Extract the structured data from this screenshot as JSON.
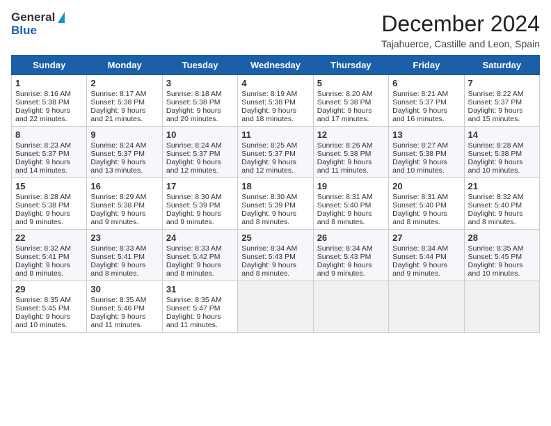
{
  "header": {
    "logo_general": "General",
    "logo_blue": "Blue",
    "month_title": "December 2024",
    "location": "Tajahuerce, Castille and Leon, Spain"
  },
  "days_of_week": [
    "Sunday",
    "Monday",
    "Tuesday",
    "Wednesday",
    "Thursday",
    "Friday",
    "Saturday"
  ],
  "weeks": [
    [
      {
        "day": 1,
        "lines": [
          "Sunrise: 8:16 AM",
          "Sunset: 5:38 PM",
          "Daylight: 9 hours",
          "and 22 minutes."
        ]
      },
      {
        "day": 2,
        "lines": [
          "Sunrise: 8:17 AM",
          "Sunset: 5:38 PM",
          "Daylight: 9 hours",
          "and 21 minutes."
        ]
      },
      {
        "day": 3,
        "lines": [
          "Sunrise: 8:18 AM",
          "Sunset: 5:38 PM",
          "Daylight: 9 hours",
          "and 20 minutes."
        ]
      },
      {
        "day": 4,
        "lines": [
          "Sunrise: 8:19 AM",
          "Sunset: 5:38 PM",
          "Daylight: 9 hours",
          "and 18 minutes."
        ]
      },
      {
        "day": 5,
        "lines": [
          "Sunrise: 8:20 AM",
          "Sunset: 5:38 PM",
          "Daylight: 9 hours",
          "and 17 minutes."
        ]
      },
      {
        "day": 6,
        "lines": [
          "Sunrise: 8:21 AM",
          "Sunset: 5:37 PM",
          "Daylight: 9 hours",
          "and 16 minutes."
        ]
      },
      {
        "day": 7,
        "lines": [
          "Sunrise: 8:22 AM",
          "Sunset: 5:37 PM",
          "Daylight: 9 hours",
          "and 15 minutes."
        ]
      }
    ],
    [
      {
        "day": 8,
        "lines": [
          "Sunrise: 8:23 AM",
          "Sunset: 5:37 PM",
          "Daylight: 9 hours",
          "and 14 minutes."
        ]
      },
      {
        "day": 9,
        "lines": [
          "Sunrise: 8:24 AM",
          "Sunset: 5:37 PM",
          "Daylight: 9 hours",
          "and 13 minutes."
        ]
      },
      {
        "day": 10,
        "lines": [
          "Sunrise: 8:24 AM",
          "Sunset: 5:37 PM",
          "Daylight: 9 hours",
          "and 12 minutes."
        ]
      },
      {
        "day": 11,
        "lines": [
          "Sunrise: 8:25 AM",
          "Sunset: 5:37 PM",
          "Daylight: 9 hours",
          "and 12 minutes."
        ]
      },
      {
        "day": 12,
        "lines": [
          "Sunrise: 8:26 AM",
          "Sunset: 5:38 PM",
          "Daylight: 9 hours",
          "and 11 minutes."
        ]
      },
      {
        "day": 13,
        "lines": [
          "Sunrise: 8:27 AM",
          "Sunset: 5:38 PM",
          "Daylight: 9 hours",
          "and 10 minutes."
        ]
      },
      {
        "day": 14,
        "lines": [
          "Sunrise: 8:28 AM",
          "Sunset: 5:38 PM",
          "Daylight: 9 hours",
          "and 10 minutes."
        ]
      }
    ],
    [
      {
        "day": 15,
        "lines": [
          "Sunrise: 8:28 AM",
          "Sunset: 5:38 PM",
          "Daylight: 9 hours",
          "and 9 minutes."
        ]
      },
      {
        "day": 16,
        "lines": [
          "Sunrise: 8:29 AM",
          "Sunset: 5:38 PM",
          "Daylight: 9 hours",
          "and 9 minutes."
        ]
      },
      {
        "day": 17,
        "lines": [
          "Sunrise: 8:30 AM",
          "Sunset: 5:39 PM",
          "Daylight: 9 hours",
          "and 9 minutes."
        ]
      },
      {
        "day": 18,
        "lines": [
          "Sunrise: 8:30 AM",
          "Sunset: 5:39 PM",
          "Daylight: 9 hours",
          "and 8 minutes."
        ]
      },
      {
        "day": 19,
        "lines": [
          "Sunrise: 8:31 AM",
          "Sunset: 5:40 PM",
          "Daylight: 9 hours",
          "and 8 minutes."
        ]
      },
      {
        "day": 20,
        "lines": [
          "Sunrise: 8:31 AM",
          "Sunset: 5:40 PM",
          "Daylight: 9 hours",
          "and 8 minutes."
        ]
      },
      {
        "day": 21,
        "lines": [
          "Sunrise: 8:32 AM",
          "Sunset: 5:40 PM",
          "Daylight: 9 hours",
          "and 8 minutes."
        ]
      }
    ],
    [
      {
        "day": 22,
        "lines": [
          "Sunrise: 8:32 AM",
          "Sunset: 5:41 PM",
          "Daylight: 9 hours",
          "and 8 minutes."
        ]
      },
      {
        "day": 23,
        "lines": [
          "Sunrise: 8:33 AM",
          "Sunset: 5:41 PM",
          "Daylight: 9 hours",
          "and 8 minutes."
        ]
      },
      {
        "day": 24,
        "lines": [
          "Sunrise: 8:33 AM",
          "Sunset: 5:42 PM",
          "Daylight: 9 hours",
          "and 8 minutes."
        ]
      },
      {
        "day": 25,
        "lines": [
          "Sunrise: 8:34 AM",
          "Sunset: 5:43 PM",
          "Daylight: 9 hours",
          "and 8 minutes."
        ]
      },
      {
        "day": 26,
        "lines": [
          "Sunrise: 8:34 AM",
          "Sunset: 5:43 PM",
          "Daylight: 9 hours",
          "and 9 minutes."
        ]
      },
      {
        "day": 27,
        "lines": [
          "Sunrise: 8:34 AM",
          "Sunset: 5:44 PM",
          "Daylight: 9 hours",
          "and 9 minutes."
        ]
      },
      {
        "day": 28,
        "lines": [
          "Sunrise: 8:35 AM",
          "Sunset: 5:45 PM",
          "Daylight: 9 hours",
          "and 10 minutes."
        ]
      }
    ],
    [
      {
        "day": 29,
        "lines": [
          "Sunrise: 8:35 AM",
          "Sunset: 5:45 PM",
          "Daylight: 9 hours",
          "and 10 minutes."
        ]
      },
      {
        "day": 30,
        "lines": [
          "Sunrise: 8:35 AM",
          "Sunset: 5:46 PM",
          "Daylight: 9 hours",
          "and 11 minutes."
        ]
      },
      {
        "day": 31,
        "lines": [
          "Sunrise: 8:35 AM",
          "Sunset: 5:47 PM",
          "Daylight: 9 hours",
          "and 11 minutes."
        ]
      },
      null,
      null,
      null,
      null
    ]
  ]
}
